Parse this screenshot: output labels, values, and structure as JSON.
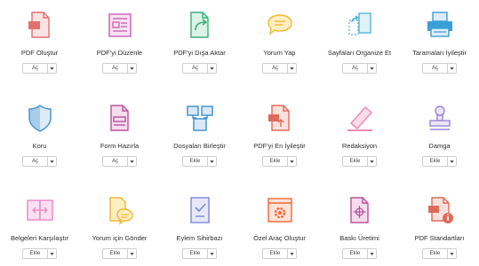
{
  "tools": [
    {
      "label": "PDF Oluştur",
      "button": "Aç",
      "icon": "create-pdf-icon",
      "color": "#e36f6f"
    },
    {
      "label": "PDF'yi Düzenle",
      "button": "Aç",
      "icon": "edit-pdf-icon",
      "color": "#c95fb3"
    },
    {
      "label": "PDF'yi Dışa Aktar",
      "button": "Aç",
      "icon": "export-pdf-icon",
      "color": "#3dae7a"
    },
    {
      "label": "Yorum Yap",
      "button": "Aç",
      "icon": "comment-icon",
      "color": "#f2b731"
    },
    {
      "label": "Sayfaları Organize Et",
      "button": "Aç",
      "icon": "organize-pages-icon",
      "color": "#58b3cf"
    },
    {
      "label": "Taramaları İyileştir",
      "button": "Aç",
      "icon": "enhance-scans-icon",
      "color": "#3a9fd6"
    },
    {
      "label": "Koru",
      "button": "Aç",
      "icon": "shield-icon",
      "color": "#4a96d4"
    },
    {
      "label": "Form Hazırla",
      "button": "Aç",
      "icon": "prepare-form-icon",
      "color": "#b8539a"
    },
    {
      "label": "Dosyaları Birleştir",
      "button": "Ekle",
      "icon": "combine-files-icon",
      "color": "#3a8ed0"
    },
    {
      "label": "PDF'yi En İyileştir",
      "button": "Ekle",
      "icon": "optimize-pdf-icon",
      "color": "#e06a5a"
    },
    {
      "label": "Redaksiyon",
      "button": "Ekle",
      "icon": "redact-icon",
      "color": "#ef88b5"
    },
    {
      "label": "Damga",
      "button": "Ekle",
      "icon": "stamp-icon",
      "color": "#9a84d6"
    },
    {
      "label": "Belgeleri Karşılaştır",
      "button": "Ekle",
      "icon": "compare-files-icon",
      "color": "#e988c6"
    },
    {
      "label": "Yorum için Gönder",
      "button": "Ekle",
      "icon": "send-for-comments-icon",
      "color": "#f2b731"
    },
    {
      "label": "Eylem Sihirbazı",
      "button": "Ekle",
      "icon": "action-wizard-icon",
      "color": "#7d86d6"
    },
    {
      "label": "Özel Araç Oluştur",
      "button": "Ekle",
      "icon": "custom-tool-icon",
      "color": "#ef6a3a"
    },
    {
      "label": "Baskı Üretimi",
      "button": "Ekle",
      "icon": "print-production-icon",
      "color": "#b8539a"
    },
    {
      "label": "PDF Standartları",
      "button": "Ekle",
      "icon": "pdf-standards-icon",
      "color": "#e06a5a"
    }
  ]
}
